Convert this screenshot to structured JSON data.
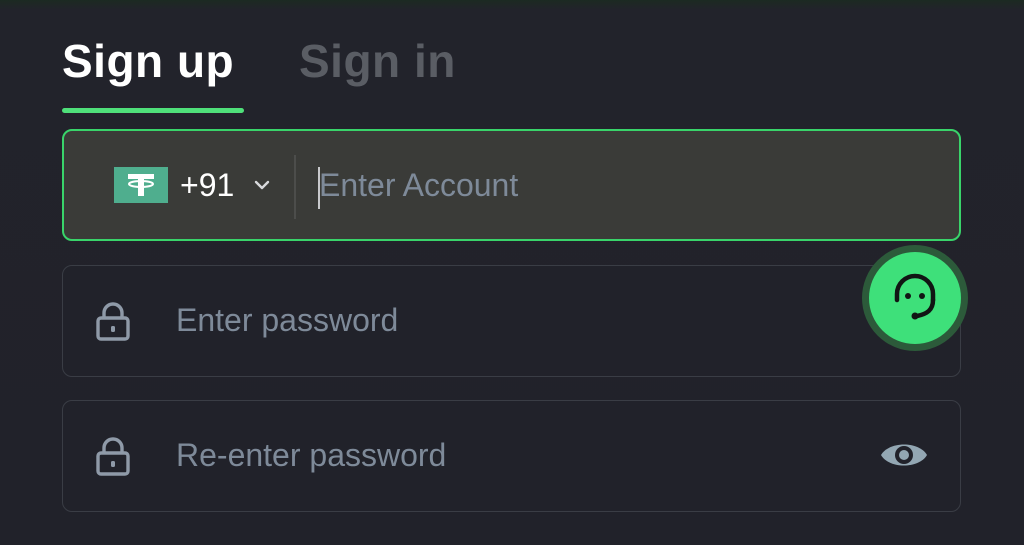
{
  "tabs": {
    "signup_label": "Sign up",
    "signin_label": "Sign in",
    "active": "Sign up"
  },
  "account": {
    "flag_icon": "tether-icon",
    "country_code": "+91",
    "placeholder": "Enter Account",
    "value": ""
  },
  "password": {
    "placeholder": "Enter password",
    "value": ""
  },
  "repassword": {
    "placeholder": "Re-enter password",
    "value": ""
  },
  "icons": {
    "lock": "lock-icon",
    "eye": "eye-icon",
    "chevron": "chevron-down-icon",
    "support": "headset-support-icon"
  },
  "colors": {
    "accent": "#4fe07a",
    "background": "#21222a",
    "field_active_bg": "#3a3b38",
    "placeholder": "#7e8a99",
    "inactive_tab": "#5a5d64"
  }
}
